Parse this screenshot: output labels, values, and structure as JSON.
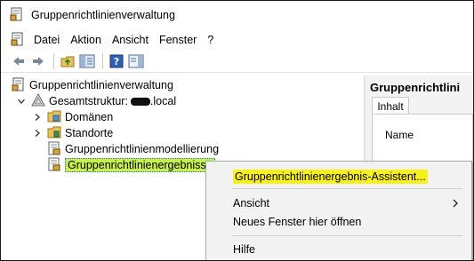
{
  "window": {
    "title": "Gruppenrichtlinienverwaltung",
    "icon": "gpmc-app-icon"
  },
  "menubar": {
    "items": [
      "Datei",
      "Aktion",
      "Ansicht",
      "Fenster",
      "?"
    ]
  },
  "toolbar": {
    "buttons": [
      "back-arrow-icon",
      "forward-arrow-icon",
      "up-folder-icon",
      "show-hide-tree-icon",
      "help-icon",
      "action-pane-icon"
    ]
  },
  "tree": {
    "root": "Gruppenrichtlinienverwaltung",
    "forest": {
      "label_prefix": "Gesamtstruktur:",
      "label_suffix": ".local"
    },
    "children": [
      {
        "label": "Domänen",
        "expandable": true
      },
      {
        "label": "Standorte",
        "expandable": true
      },
      {
        "label": "Gruppenrichtlinienmodellierung",
        "expandable": false
      },
      {
        "label": "Gruppenrichtlinienergebnisse",
        "expandable": false,
        "selected": true
      }
    ]
  },
  "right_pane": {
    "header": "Gruppenrichtlini",
    "tab": "Inhalt",
    "column": "Name"
  },
  "context_menu": {
    "items": [
      {
        "label": "Gruppenrichtlinienergebnis-Assistent...",
        "highlighted": true
      },
      {
        "label": "Ansicht",
        "submenu": true
      },
      {
        "label": "Neues Fenster hier öffnen"
      },
      {
        "label": "Hilfe"
      }
    ]
  },
  "colors": {
    "selection": "#c8f04a",
    "highlight": "#f7f01c"
  }
}
